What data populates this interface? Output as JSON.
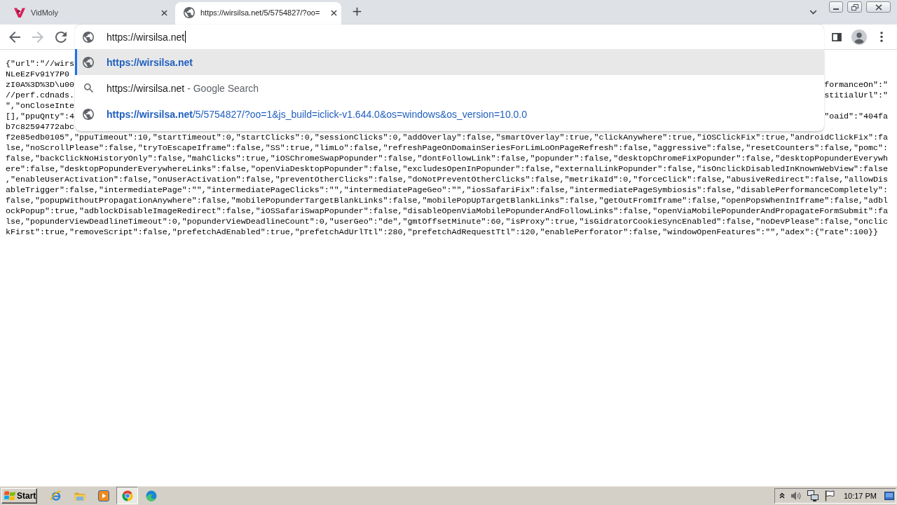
{
  "browser": {
    "tabs": [
      {
        "kind": "site",
        "title": "VidMoly",
        "selected": false
      },
      {
        "kind": "web",
        "title": "https://wirsilsa.net/5/5754827/?oo=",
        "selected": true
      }
    ],
    "nav_buttons": [
      {
        "kind": "back",
        "disabled": false
      },
      {
        "kind": "forward",
        "disabled": true
      },
      {
        "kind": "reload",
        "disabled": false
      }
    ],
    "address_bar": {
      "value": "https://wirsilsa.net",
      "focused": true
    },
    "suggestions": [
      {
        "kind": "url",
        "selected": true,
        "text": "https://wirsilsa.net"
      },
      {
        "kind": "search",
        "selected": false,
        "text": "https://wirsilsa.net",
        "description": "- Google Search"
      },
      {
        "kind": "url",
        "selected": false,
        "text": "https://wirsilsa.net",
        "rest": "/5/5754827/?oo=1&js_build=iclick-v1.644.0&os=windows&os_version=10.0.0"
      }
    ]
  },
  "page": {
    "lines": [
      {
        "text": "{\"url\":\"//wirs"
      },
      {
        "text": "NLeEzFv91Y7P0"
      },
      {
        "text": "zI0A%3D%3D\\u00",
        "tail": "formanceOn\":\""
      },
      {
        "text": "//perf.cdnads.",
        "tail": "stitialUrl\":\""
      },
      {
        "text": "\",\"onCloseInte"
      },
      {
        "text": "[],\"ppuQnty\":4",
        "tail": "\"oaid\":\"404fa"
      },
      {
        "text": "b7c82594772abc"
      },
      {
        "text": "f2e85edb0105\",\"ppuTimeout\":10,\"startTimeout\":0,\"startClicks\":0,\"sessionClicks\":0,\"addOverlay\":false,\"smartOverlay\":true,\"clickAnywhere\":true,\"iOSClickFix\":true,\"androidClickFix\":fa"
      },
      {
        "text": "lse,\"noScrollPlease\":false,\"tryToEscapeIframe\":false,\"SS\":true,\"limLo\":false,\"refreshPageOnDomainSeriesForLimLoOnPageRefresh\":false,\"aggressive\":false,\"resetCounters\":false,\"pomc\":"
      },
      {
        "text": "false,\"backClickNoHistoryOnly\":false,\"mahClicks\":true,\"iOSChromeSwapPopunder\":false,\"dontFollowLink\":false,\"popunder\":false,\"desktopChromeFixPopunder\":false,\"desktopPopunderEverywh"
      },
      {
        "text": "ere\":false,\"desktopPopunderEverywhereLinks\":false,\"openViaDesktopPopunder\":false,\"excludesOpenInPopunder\":false,\"externalLinkPopunder\":false,\"isOnclickDisabledInKnownWebView\":false"
      },
      {
        "text": ",\"enableUserActivation\":false,\"onUserActivation\":false,\"preventOtherClicks\":false,\"doNotPreventOtherClicks\":false,\"metrikaId\":0,\"forceClick\":false,\"abusiveRedirect\":false,\"allowDis"
      },
      {
        "text": "ableTrigger\":false,\"intermediatePage\":\"\",\"intermediatePageClicks\":\"\",\"intermediatePageGeo\":\"\",\"iosSafariFix\":false,\"intermediatePageSymbiosis\":false,\"disablePerformanceCompletely\":"
      },
      {
        "text": "false,\"popupWithoutPropagationAnywhere\":false,\"mobilePopunderTargetBlankLinks\":false,\"mobilePopUpTargetBlankLinks\":false,\"getOutFromIframe\":false,\"openPopsWhenInIframe\":false,\"adbl"
      },
      {
        "text": "ockPopup\":true,\"adblockDisableImageRedirect\":false,\"iOSSafariSwapPopunder\":false,\"disableOpenViaMobilePopunderAndFollowLinks\":false,\"openViaMobilePopunderAndPropagateFormSubmit\":fa"
      },
      {
        "text": "lse,\"popunderViewDeadlineTimeout\":0,\"popunderViewDeadlineCount\":0,\"userGeo\":\"de\",\"gmtOffsetMinute\":60,\"isProxy\":true,\"isGidratorCookieSyncEnabled\":false,\"noDevPlease\":false,\"onclic"
      },
      {
        "text": "kFirst\":true,\"removeScript\":false,\"prefetchAdEnabled\":true,\"prefetchAdUrlTtl\":280,\"prefetchAdRequestTtl\":120,\"enablePerforator\":false,\"windowOpenFeatures\":\"\",\"adex\":{\"rate\":100}}"
      }
    ]
  },
  "taskbar": {
    "start_label": "Start",
    "apps": [
      {
        "kind": "ie",
        "selected": false
      },
      {
        "kind": "explorer",
        "selected": false
      },
      {
        "kind": "media",
        "selected": false
      },
      {
        "kind": "chrome",
        "selected": true
      },
      {
        "kind": "edge",
        "selected": false
      }
    ],
    "clock": "10:17 PM"
  }
}
